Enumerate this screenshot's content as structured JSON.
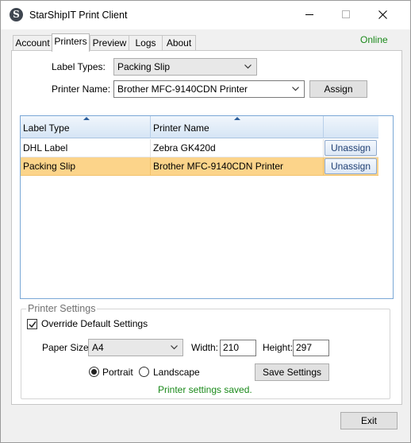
{
  "window": {
    "title": "StarShipIT Print Client",
    "app_icon_letter": "S",
    "status": "Online",
    "status_color": "#1b8a1b"
  },
  "tabs": [
    {
      "label": "Account",
      "active": false
    },
    {
      "label": "Printers",
      "active": true
    },
    {
      "label": "Preview",
      "active": false
    },
    {
      "label": "Logs",
      "active": false
    },
    {
      "label": "About",
      "active": false
    }
  ],
  "assignment": {
    "label_types_label": "Label Types:",
    "label_type_value": "Packing Slip",
    "printer_name_label": "Printer Name:",
    "printer_name_value": "Brother MFC-9140CDN Printer",
    "assign_button": "Assign"
  },
  "grid": {
    "columns": [
      "Label Type",
      "Printer Name",
      ""
    ],
    "rows": [
      {
        "label_type": "DHL Label",
        "printer_name": "Zebra GK420d",
        "action": "Unassign",
        "selected": false
      },
      {
        "label_type": "Packing Slip",
        "printer_name": "Brother MFC-9140CDN Printer",
        "action": "Unassign",
        "selected": true
      }
    ],
    "selection_color": "#fcd48a"
  },
  "printer_settings": {
    "title": "Printer Settings",
    "override_label": "Override Default Settings",
    "override_checked": true,
    "paper_size_label": "Paper Size:",
    "paper_size_value": "A4",
    "width_label": "Width:",
    "width_value": "210",
    "height_label": "Height:",
    "height_value": "297",
    "orientation_portrait": "Portrait",
    "orientation_landscape": "Landscape",
    "orientation_selected": "Portrait",
    "save_button": "Save Settings",
    "status_message": "Printer settings saved."
  },
  "footer": {
    "exit_button": "Exit"
  }
}
